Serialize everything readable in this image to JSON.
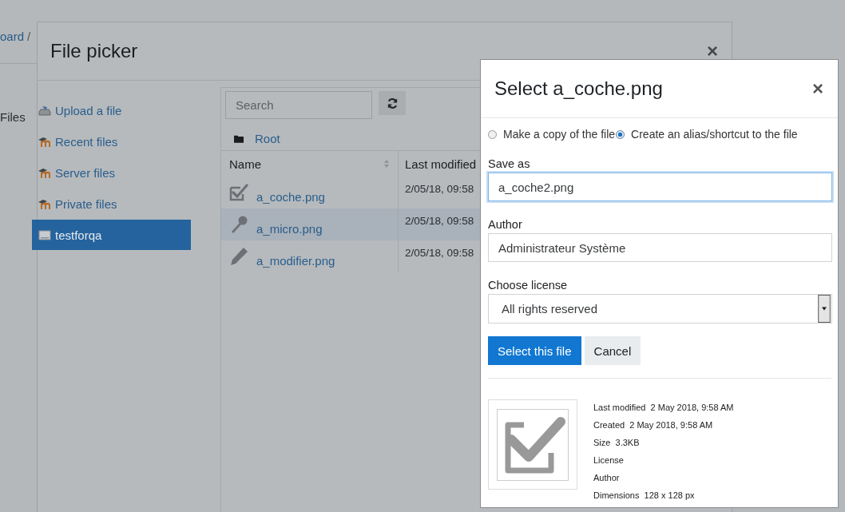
{
  "background": {
    "breadcrumb": "oard",
    "separator": "/",
    "side_label": "Files"
  },
  "file_picker": {
    "title": "File picker",
    "close": "×",
    "sidebar": [
      {
        "label": "Upload a file",
        "kind": "upload",
        "selected": false
      },
      {
        "label": "Recent files",
        "kind": "repository",
        "selected": false
      },
      {
        "label": "Server files",
        "kind": "repository",
        "selected": false
      },
      {
        "label": "Private files",
        "kind": "repository",
        "selected": false
      },
      {
        "label": "testforqa",
        "kind": "drive",
        "selected": true
      }
    ],
    "search": {
      "placeholder": "Search"
    },
    "path": "Root",
    "table": {
      "columns": [
        "Name",
        "Last modified"
      ],
      "rows": [
        {
          "name": "a_coche.png",
          "kind": "check",
          "modified": "2/05/18, 09:58",
          "selected": false
        },
        {
          "name": "a_micro.png",
          "kind": "microphone",
          "modified": "2/05/18, 09:58",
          "selected": true
        },
        {
          "name": "a_modifier.png",
          "kind": "pencil",
          "modified": "2/05/18, 09:58",
          "selected": false
        }
      ]
    }
  },
  "select_dialog": {
    "title": "Select a_coche.png",
    "close": "×",
    "options": [
      {
        "label": "Make a copy of the file",
        "selected": false
      },
      {
        "label": "Create an alias/shortcut to the file",
        "selected": true
      }
    ],
    "save_as": {
      "label": "Save as",
      "value": "a_coche2.png"
    },
    "author": {
      "label": "Author",
      "value": "Administrateur Système"
    },
    "license": {
      "label": "Choose license",
      "value": "All rights reserved"
    },
    "buttons": [
      {
        "label": "Select this file",
        "kind": "primary"
      },
      {
        "label": "Cancel",
        "kind": "secondary"
      }
    ],
    "details": [
      {
        "label": "Last modified",
        "value": "2 May 2018, 9:58 AM"
      },
      {
        "label": "Created",
        "value": "2 May 2018, 9:58 AM"
      },
      {
        "label": "Size",
        "value": "3.3KB"
      },
      {
        "label": "License"
      },
      {
        "label": "Author"
      },
      {
        "label": "Dimensions",
        "value": "128 x 128 px"
      }
    ]
  }
}
